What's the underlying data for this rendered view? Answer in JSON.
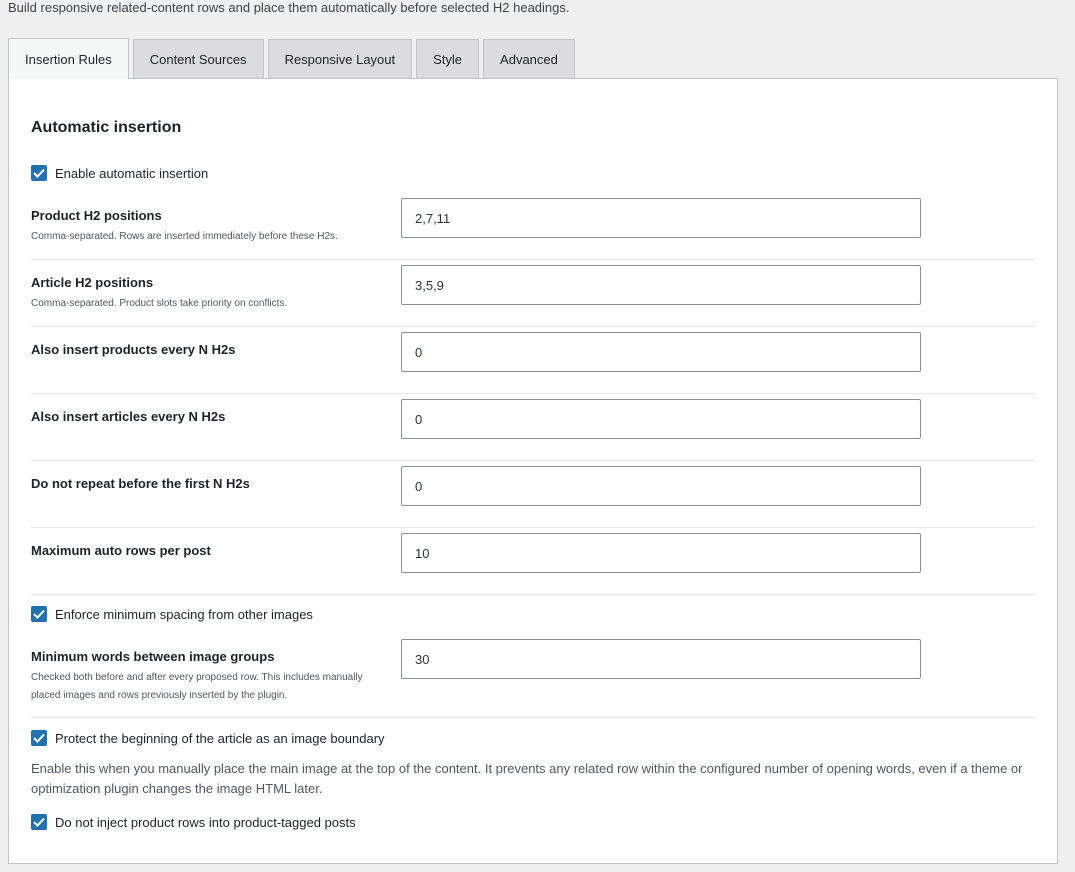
{
  "intro": "Build responsive related-content rows and place them automatically before selected H2 headings.",
  "tabs": [
    {
      "label": "Insertion Rules",
      "active": true
    },
    {
      "label": "Content Sources",
      "active": false
    },
    {
      "label": "Responsive Layout",
      "active": false
    },
    {
      "label": "Style",
      "active": false
    },
    {
      "label": "Advanced",
      "active": false
    }
  ],
  "section_title": "Automatic insertion",
  "checkboxes": {
    "enable_auto": {
      "label": "Enable automatic insertion",
      "checked": true
    },
    "enforce_spacing": {
      "label": "Enforce minimum spacing from other images",
      "checked": true
    },
    "protect_beginning": {
      "label": "Protect the beginning of the article as an image boundary",
      "checked": true
    },
    "no_product_rows": {
      "label": "Do not inject product rows into product-tagged posts",
      "checked": true
    }
  },
  "fields": {
    "product_h2": {
      "label": "Product H2 positions",
      "help": "Comma-separated. Rows are inserted immediately before these H2s.",
      "value": "2,7,11"
    },
    "article_h2": {
      "label": "Article H2 positions",
      "help": "Comma-separated. Product slots take priority on conflicts.",
      "value": "3,5,9"
    },
    "products_every_n": {
      "label": "Also insert products every N H2s",
      "value": "0"
    },
    "articles_every_n": {
      "label": "Also insert articles every N H2s",
      "value": "0"
    },
    "no_repeat_first_n": {
      "label": "Do not repeat before the first N H2s",
      "value": "0"
    },
    "max_rows": {
      "label": "Maximum auto rows per post",
      "value": "10"
    },
    "min_words": {
      "label": "Minimum words between image groups",
      "help": "Checked both before and after every proposed row. This includes manually placed images and rows previously inserted by the plugin.",
      "value": "30"
    }
  },
  "protect_description": "Enable this when you manually place the main image at the top of the content. It prevents any related row within the configured number of opening words, even if a theme or optimization plugin changes the image HTML later.",
  "colors": {
    "accent": "#2271b1",
    "background": "#f0f0f1",
    "panel": "#ffffff"
  }
}
